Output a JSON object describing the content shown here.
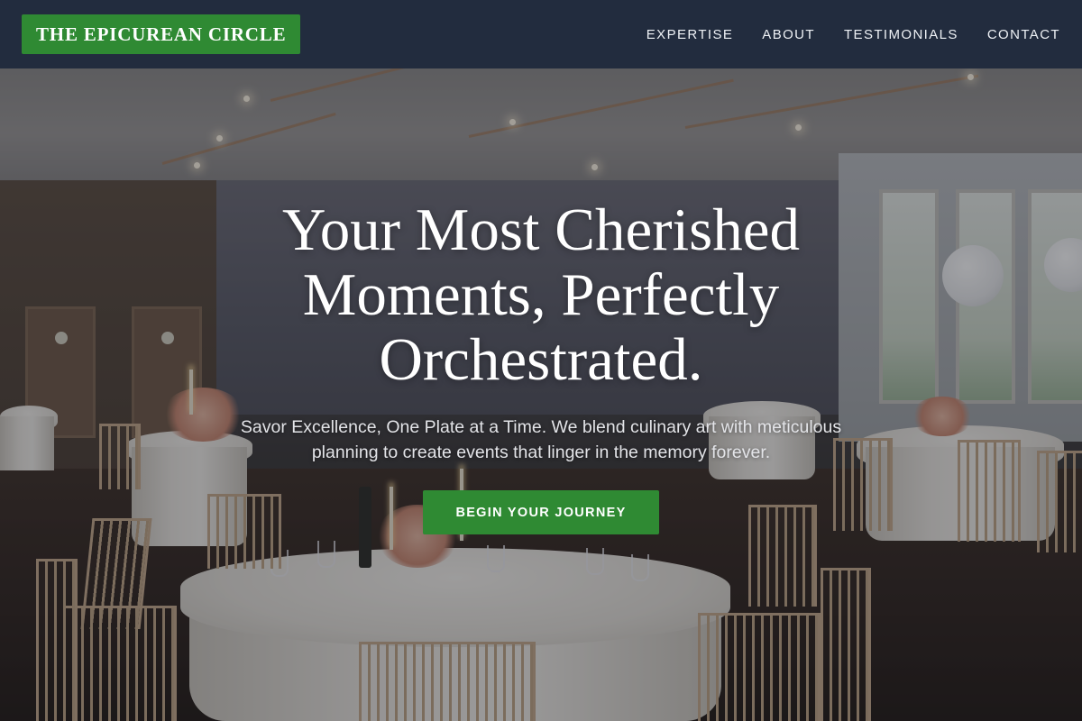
{
  "header": {
    "brand": "THE EPICUREAN CIRCLE",
    "nav": [
      {
        "label": "EXPERTISE"
      },
      {
        "label": "ABOUT"
      },
      {
        "label": "TESTIMONIALS"
      },
      {
        "label": "CONTACT"
      }
    ]
  },
  "hero": {
    "title": "Your Most Cherished Moments, Perfectly Orchestrated.",
    "subtitle": "Savor Excellence, One Plate at a Time. We blend culinary art with meticulous planning to create events that linger in the memory forever.",
    "cta_label": "BEGIN YOUR JOURNEY",
    "background_image": "banquet-hall-photo"
  },
  "colors": {
    "header_bg": "#222c3e",
    "accent_green": "#2f8a33",
    "text_light": "#ffffff"
  }
}
